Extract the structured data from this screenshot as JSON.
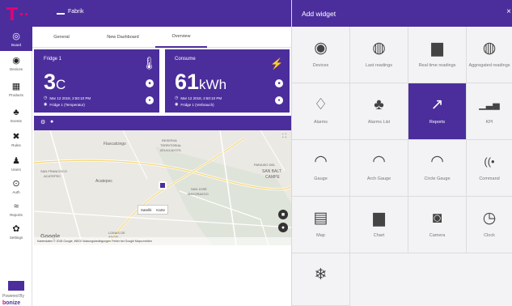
{
  "app": {
    "title": "Fabrik"
  },
  "sidebar": {
    "items": [
      {
        "label": "Board",
        "icon": "dashboard-icon",
        "glyph": "◎",
        "active": true
      },
      {
        "label": "Devices",
        "icon": "device-icon",
        "glyph": "◉"
      },
      {
        "label": "Products",
        "icon": "product-icon",
        "glyph": "▦"
      },
      {
        "label": "Events",
        "icon": "bell-icon",
        "glyph": "♣"
      },
      {
        "label": "Rules",
        "icon": "rules-icon",
        "glyph": "✖"
      },
      {
        "label": "Users",
        "icon": "user-icon",
        "glyph": "♟"
      },
      {
        "label": "Auth",
        "icon": "auth-icon",
        "glyph": "⊙"
      },
      {
        "label": "Reports",
        "icon": "reports-icon",
        "glyph": "≈"
      },
      {
        "label": "Settings",
        "icon": "gear-icon",
        "glyph": "✿"
      }
    ],
    "powered_by": "Powered By",
    "brand_prefix": "b",
    "brand_rest": "onize"
  },
  "tabs": [
    {
      "label": "General"
    },
    {
      "label": "New Dashboard"
    },
    {
      "label": "Overview",
      "active": true
    }
  ],
  "cards": [
    {
      "title": "Fridge 1",
      "value": "3",
      "unit": "C",
      "timestamp": "Mar 12 2018, 2:50:10 PM",
      "device": "Fridge 1 (Temperatur)",
      "icon": "thermometer-icon"
    },
    {
      "title": "Consume",
      "value": "61",
      "unit": "kWh",
      "timestamp": "Mar 12 2018, 2:50:10 PM",
      "device": "Fridge 1 (Verbrauch)",
      "icon": "power-icon"
    }
  ],
  "map": {
    "labels": {
      "flaxcalcingo": "Flaxcalcingo",
      "reserva": "RESERVA",
      "territorial": "TERRITORIAL",
      "atlixcayotl": "ATLIXCAYOTL",
      "san_francisco": "SAN FRANCISCO",
      "acatepec_caps": "ACATEPEC",
      "acatepec": "Acatepec",
      "paraiso_del": "PARAISO DEL",
      "san_balt": "SAN BALT",
      "campe": "CAMPE",
      "san_jose": "SAN JOSÉ",
      "mayorazgo": "MAYORAZGO",
      "lomas_de": "LOMAS DE",
      "angelopolis": "ANGEL..."
    },
    "view_satellite": "Satellit",
    "view_map": "Karte",
    "footer": "Kartendaten © 2018 Google, INEGI   Nutzungsbedingungen   Fehler bei Google Maps melden",
    "google": "Google"
  },
  "widget_panel": {
    "title": "Add widget",
    "close": "×",
    "widgets": [
      {
        "label": "Devices",
        "icon": "target-icon",
        "glyph": "◉"
      },
      {
        "label": "Last readings",
        "icon": "spiral-icon",
        "glyph": "◍"
      },
      {
        "label": "Real time readings",
        "icon": "bar-chart-icon",
        "glyph": "▆"
      },
      {
        "label": "Aggregated readings",
        "icon": "spiral-icon",
        "glyph": "◍"
      },
      {
        "label": "Alarms",
        "icon": "bell-outline-icon",
        "glyph": "♢"
      },
      {
        "label": "Alarms List",
        "icon": "bell-icon",
        "glyph": "♣"
      },
      {
        "label": "Reports",
        "icon": "trend-up-icon",
        "glyph": "↗",
        "selected": true
      },
      {
        "label": "KPI",
        "icon": "kpi-icon",
        "glyph": "▁▃▅"
      },
      {
        "label": "Gauge",
        "icon": "gauge-icon",
        "glyph": "◠"
      },
      {
        "label": "Arch Gauge",
        "icon": "arch-gauge-icon",
        "glyph": "◠"
      },
      {
        "label": "Circle Gauge",
        "icon": "circle-gauge-icon",
        "glyph": "◠"
      },
      {
        "label": "Command",
        "icon": "broadcast-icon",
        "glyph": "((•"
      },
      {
        "label": "Map",
        "icon": "map-icon",
        "glyph": "▤"
      },
      {
        "label": "Chart",
        "icon": "chart-icon",
        "glyph": "▆"
      },
      {
        "label": "Camera",
        "icon": "camera-icon",
        "glyph": "◙"
      },
      {
        "label": "Clock",
        "icon": "stopwatch-icon",
        "glyph": "◷"
      },
      {
        "label": "",
        "icon": "snowflake-icon",
        "glyph": "❄"
      }
    ]
  },
  "colors": {
    "primary": "#4b2e9c",
    "brand_magenta": "#e20074"
  }
}
